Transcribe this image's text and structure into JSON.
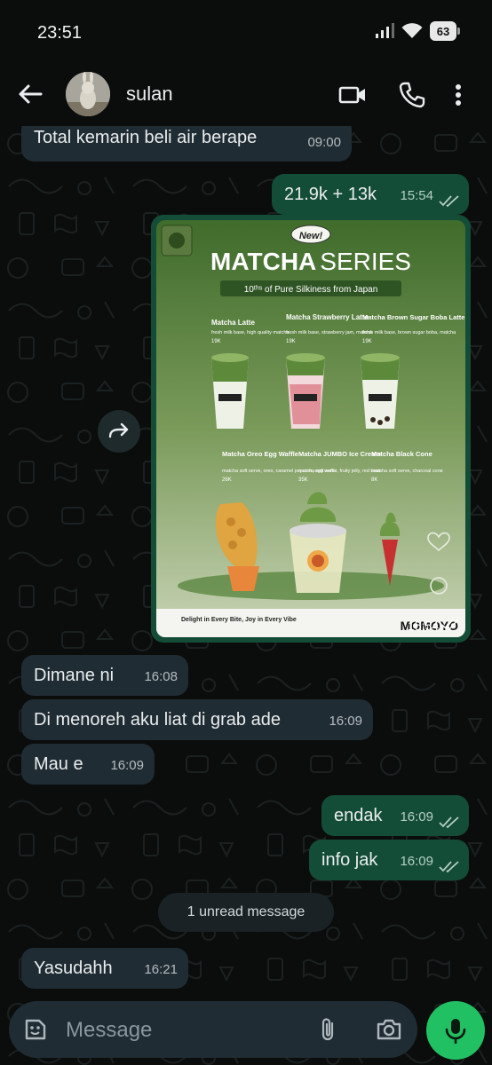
{
  "status_bar": {
    "time": "23:51",
    "battery": "63"
  },
  "header": {
    "contact_name": "sulan"
  },
  "messages": [
    {
      "dir": "in",
      "text": "Total kemarin beli air berape",
      "time": "09:00"
    },
    {
      "dir": "out",
      "text": "21.9k + 13k",
      "time": "15:54"
    },
    {
      "dir": "in",
      "text": "Dimane ni",
      "time": "16:08"
    },
    {
      "dir": "in",
      "text": "Di menoreh aku liat di grab ade",
      "time": "16:09"
    },
    {
      "dir": "in",
      "text": "Mau e",
      "time": "16:09"
    },
    {
      "dir": "out",
      "text": "endak",
      "time": "16:09"
    },
    {
      "dir": "out",
      "text": "info jak",
      "time": "16:09"
    },
    {
      "dir": "in",
      "text": "Yasudahh",
      "time": "16:21"
    }
  ],
  "image_message": {
    "time": "15:54",
    "poster": {
      "badge": "New!",
      "title_bold": "MATCHA",
      "title_light": "SERIES",
      "subtitle": "10ᵗʰˢ of Pure Silkiness from Japan",
      "brand": "MOMOYO",
      "footer_tagline": "Delight in Every Bite, Joy in Every Vibe",
      "footer_logo": "MOMOYO",
      "items": [
        {
          "name": "Matcha Latte",
          "desc": "fresh milk base, high quality matcha",
          "price": "19K"
        },
        {
          "name": "Matcha Strawberry Latte",
          "desc": "fresh milk base, strawberry jam, matcha",
          "price": "19K"
        },
        {
          "name": "Matcha Brown Sugar Boba Latte",
          "desc": "fresh milk base, brown sugar boba, matcha",
          "price": "19K"
        },
        {
          "name": "Matcha Oreo Egg Waffle",
          "desc": "matcha soft serve, oreo, caramel popcorn, egg waffle",
          "price": "26K"
        },
        {
          "name": "Matcha JUMBO Ice Cream",
          "desc": "matcha soft serve, fruity jelly, red bean",
          "price": "35K"
        },
        {
          "name": "Matcha Black Cone",
          "desc": "matcha soft serve, charcoal cone",
          "price": "8K"
        }
      ]
    }
  },
  "unread_divider": "1 unread message",
  "composer": {
    "placeholder": "Message"
  },
  "colors": {
    "incoming": "#202c33",
    "outgoing": "#144d37",
    "accent": "#21c063",
    "background": "#0b0d0c"
  },
  "icons": [
    "back-arrow-icon",
    "video-call-icon",
    "phone-icon",
    "more-vert-icon",
    "forward-icon",
    "emoji-icon",
    "attach-icon",
    "camera-icon",
    "mic-icon",
    "heart-icon",
    "smiley-icon"
  ]
}
